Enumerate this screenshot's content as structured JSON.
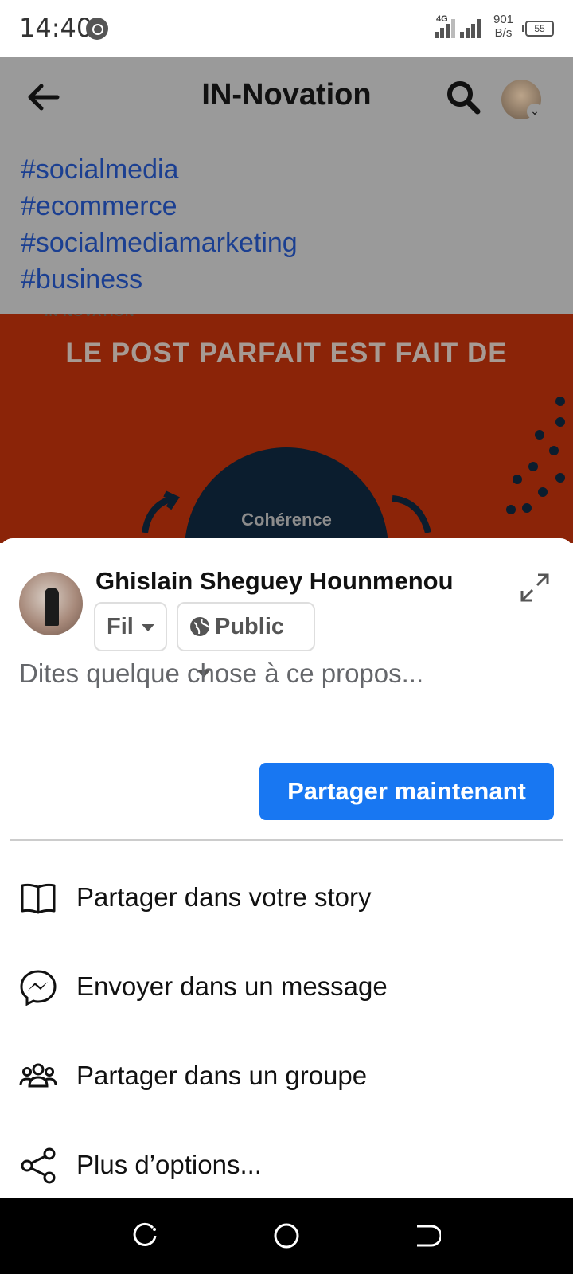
{
  "status_bar": {
    "time": "14:40",
    "network": "4G",
    "speed_value": "901",
    "speed_unit": "B/s",
    "battery": "55"
  },
  "app_bar": {
    "title": "IN-Novation"
  },
  "post": {
    "hashtags": [
      "#socialmedia",
      "#ecommerce",
      "#socialmediamarketing",
      "#business"
    ],
    "image_title": "LE POST PARFAIT EST FAIT DE",
    "image_logo": "IN NOVATION",
    "image_circle_label": "Cohérence"
  },
  "share_sheet": {
    "user_name": "Ghislain Sheguey Hounmenou",
    "destination": "Fil",
    "audience": "Public",
    "compose_placeholder": "Dites quelque chose à ce propos...",
    "share_button": "Partager maintenant",
    "options": [
      {
        "label": "Partager dans votre story",
        "icon": "book-icon"
      },
      {
        "label": "Envoyer dans un message",
        "icon": "messenger-icon"
      },
      {
        "label": "Partager dans un groupe",
        "icon": "group-icon"
      },
      {
        "label": "Plus d’options...",
        "icon": "share-icon"
      }
    ]
  },
  "colors": {
    "accent": "#1877f2",
    "hashtag": "#1b3f91",
    "overlay": "#9a9a9a",
    "post_image_bg": "#8b2408"
  }
}
